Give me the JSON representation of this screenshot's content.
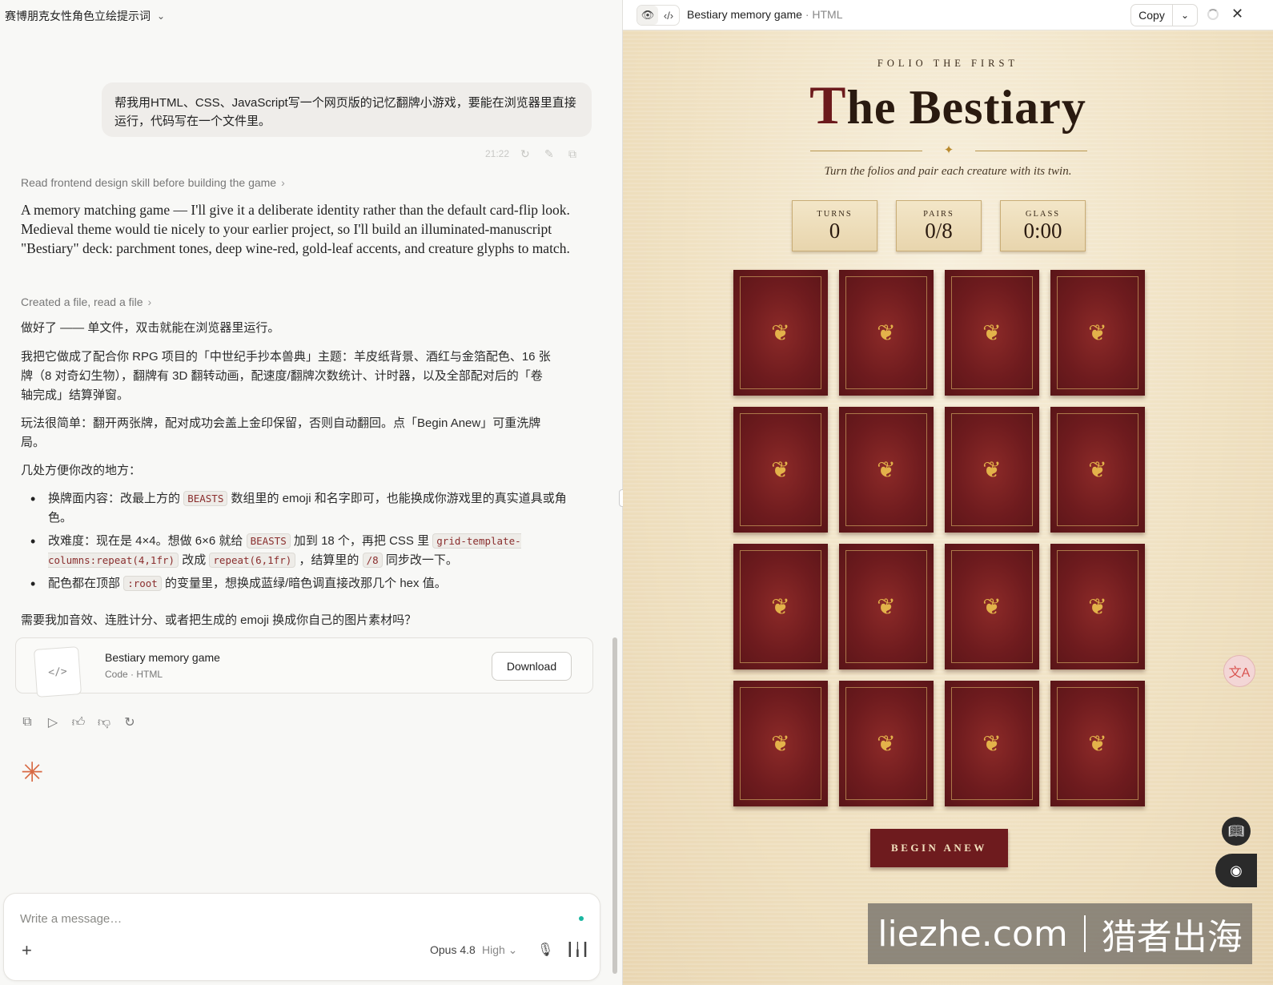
{
  "conversation": {
    "title": "赛博朋克女性角色立绘提示词"
  },
  "user_message": {
    "text": "帮我用HTML、CSS、JavaScript写一个网页版的记忆翻牌小游戏，要能在浏览器里直接运行，代码写在一个文件里。",
    "time": "21:22"
  },
  "steps": {
    "step1": "Read frontend design skill before building the game",
    "step2": "Created a file, read a file"
  },
  "assistant": {
    "intro": "A memory matching game — I'll give it a deliberate identity rather than the default card-flip look. Medieval theme would tie nicely to your earlier project, so I'll build an illuminated-manuscript \"Bestiary\" deck: parchment tones, deep wine-red, gold-leaf accents, and creature glyphs to match.",
    "p1": "做好了 —— 单文件，双击就能在浏览器里运行。",
    "p2": "我把它做成了配合你 RPG 项目的「中世纪手抄本兽典」主题：羊皮纸背景、酒红与金箔配色、16 张牌（8 对奇幻生物），翻牌有 3D 翻转动画，配速度/翻牌次数统计、计时器，以及全部配对后的「卷轴完成」结算弹窗。",
    "p3": "玩法很简单：翻开两张牌，配对成功会盖上金印保留，否则自动翻回。点「Begin Anew」可重洗牌局。",
    "p4": "几处方便你改的地方：",
    "b1_a": "换牌面内容：改最上方的",
    "b1_code": "BEASTS",
    "b1_b": "数组里的 emoji 和名字即可，也能换成你游戏里的真实道具或角色。",
    "b2_a": "改难度：现在是 4×4。想做 6×6 就给",
    "b2_code1": "BEASTS",
    "b2_b": "加到 18 个，再把 CSS 里",
    "b2_code2": "grid-template-columns:repeat(4,1fr)",
    "b2_c": "改成",
    "b2_code3": "repeat(6,1fr)",
    "b2_d": "，结算里的",
    "b2_code4": "/8",
    "b2_e": "同步改一下。",
    "b3_a": "配色都在顶部",
    "b3_code": ":root",
    "b3_b": "的变量里，想换成蓝绿/暗色调直接改那几个 hex 值。",
    "p5": "需要我加音效、连胜计分、或者把生成的 emoji 换成你自己的图片素材吗？"
  },
  "artifact": {
    "title": "Bestiary memory game",
    "meta": "Code · HTML",
    "download": "Download",
    "thumb": "</>"
  },
  "composer": {
    "placeholder": "Write a message…",
    "model": "Opus 4.8",
    "effort": "High"
  },
  "preview": {
    "title": "Bestiary memory game",
    "title_meta": "· HTML",
    "copy": "Copy"
  },
  "game": {
    "folio": "FOLIO THE FIRST",
    "title_cap": "T",
    "title_rest": "he Bestiary",
    "subtitle": "Turn the folios and pair each creature with its twin.",
    "stats": [
      {
        "label": "TURNS",
        "value": "0"
      },
      {
        "label": "PAIRS",
        "value": "0/8"
      },
      {
        "label": "GLASS",
        "value": "0:00"
      }
    ],
    "card_count": 16,
    "card_glyph": "❦",
    "begin": "BEGIN ANEW"
  },
  "watermark": {
    "left": "liezhe.com",
    "right": "猎者出海"
  },
  "colors": {
    "wine": "#6e1b1e",
    "gold": "#e3b24a",
    "parchment": "#f0e3c6"
  }
}
